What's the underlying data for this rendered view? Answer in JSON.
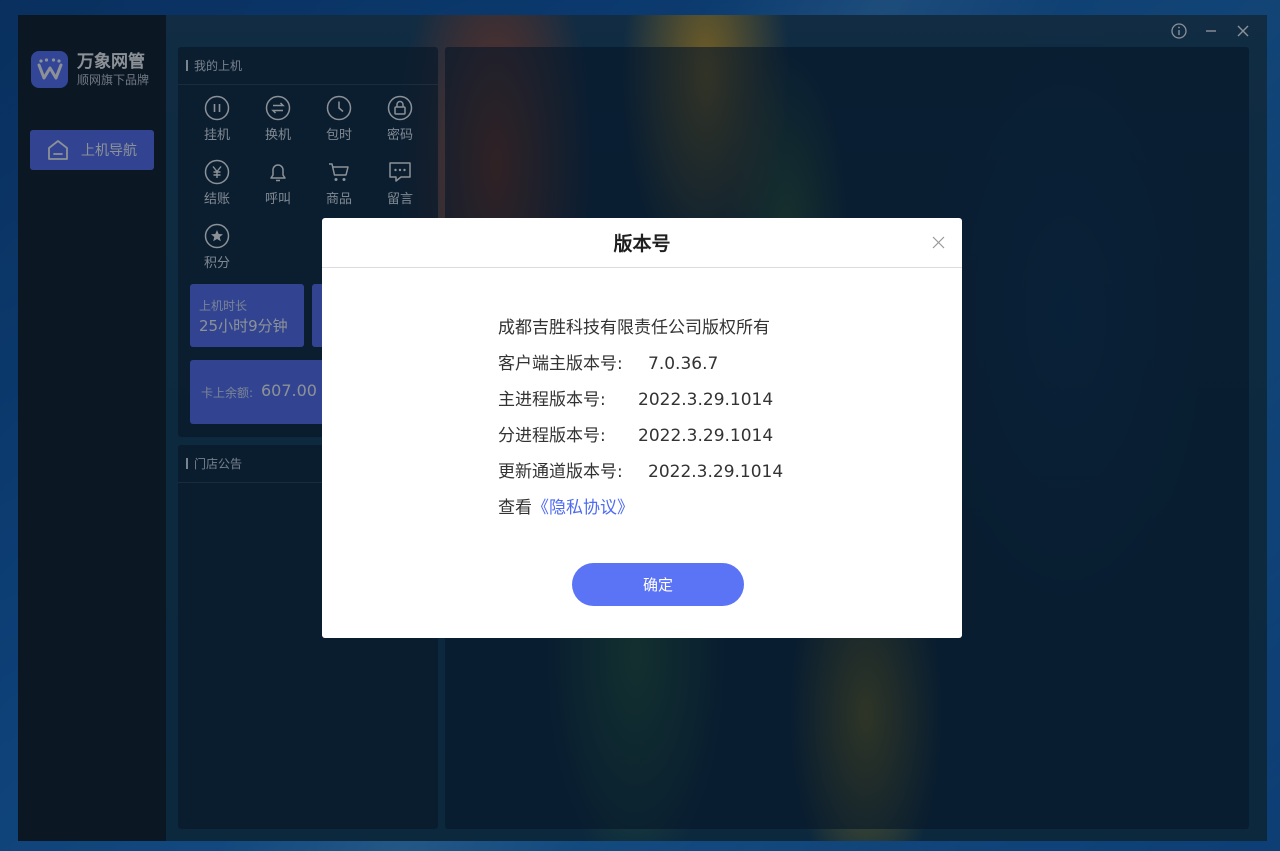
{
  "brand": {
    "name": "万象网管",
    "subtitle": "顺网旗下品牌"
  },
  "sidebar": {
    "items": [
      {
        "label": "上机导航"
      }
    ]
  },
  "my_session": {
    "title": "我的上机",
    "actions": [
      {
        "label": "挂机",
        "icon": "pause-icon"
      },
      {
        "label": "换机",
        "icon": "swap-icon"
      },
      {
        "label": "包时",
        "icon": "clock-icon"
      },
      {
        "label": "密码",
        "icon": "lock-icon"
      },
      {
        "label": "结账",
        "icon": "yen-icon"
      },
      {
        "label": "呼叫",
        "icon": "bell-icon"
      },
      {
        "label": "商品",
        "icon": "cart-icon"
      },
      {
        "label": "留言",
        "icon": "message-icon"
      },
      {
        "label": "积分",
        "icon": "star-icon"
      }
    ],
    "online_time_label": "上机时长",
    "online_time_value": "25小时9分钟",
    "balance_label": "卡上余额:",
    "balance_value": "607.00"
  },
  "notice": {
    "title": "门店公告"
  },
  "dialog": {
    "title": "版本号",
    "copyright": "成都吉胜科技有限责任公司版权所有",
    "rows": [
      {
        "label": "客户端主版本号:",
        "value": "7.0.36.7"
      },
      {
        "label": "主进程版本号:",
        "value": "2022.3.29.1014"
      },
      {
        "label": "分进程版本号:",
        "value": "2022.3.29.1014"
      },
      {
        "label": "更新通道版本号:",
        "value": "2022.3.29.1014"
      }
    ],
    "privacy_prefix": "查看",
    "privacy_link": "《隐私协议》",
    "ok_label": "确定"
  },
  "colors": {
    "accent": "#5b73f5",
    "link": "#4f6bf2",
    "sidebar": "#16222e"
  }
}
